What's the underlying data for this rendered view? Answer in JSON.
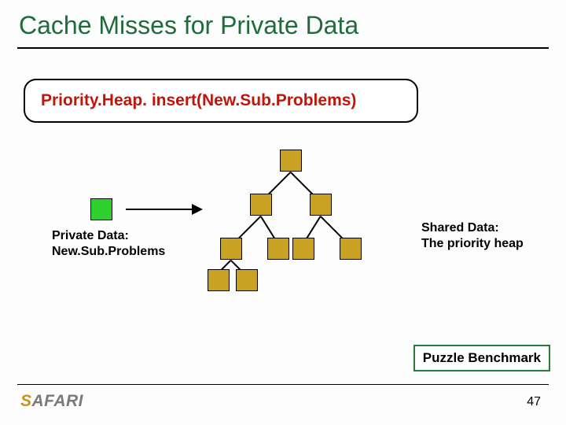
{
  "title": "Cache Misses for Private Data",
  "code_line": "Priority.Heap. insert(New.Sub.Problems)",
  "private_label_l1": "Private Data:",
  "private_label_l2": "New.Sub.Problems",
  "shared_label_l1": "Shared Data:",
  "shared_label_l2": "The priority heap",
  "puzzle_box": "Puzzle Benchmark",
  "logo_first": "S",
  "logo_rest": "AFARI",
  "page_number": "47"
}
